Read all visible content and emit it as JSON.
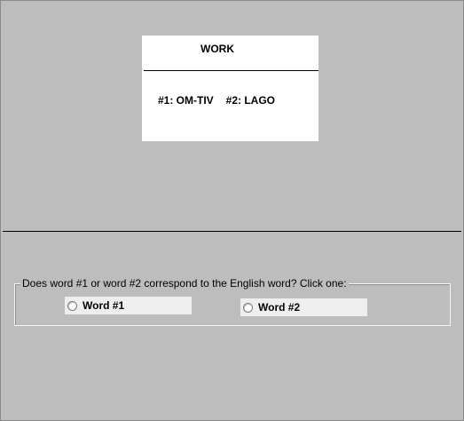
{
  "card": {
    "title": "WORK",
    "word1": "#1: OM-TIV",
    "word2": "#2: LAGO"
  },
  "question": {
    "prompt": "Does word #1 or word #2 correspond to the English word?  Click one:",
    "options": [
      {
        "label": "Word #1",
        "selected": false
      },
      {
        "label": "Word #2",
        "selected": false
      }
    ]
  }
}
